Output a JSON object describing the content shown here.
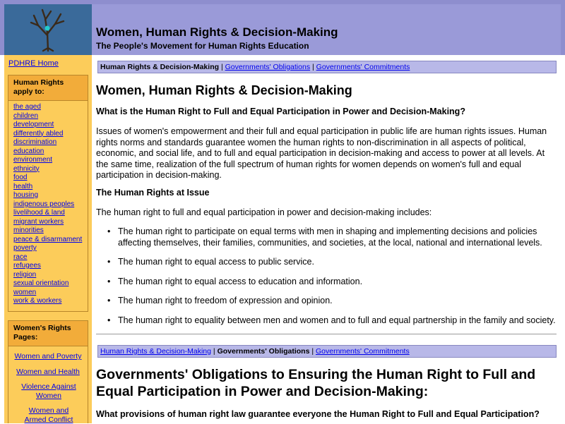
{
  "header": {
    "title": "Women, Human Rights & Decision-Making",
    "subtitle": "The People's Movement for Human Rights Education"
  },
  "sidebar": {
    "home_link": "PDHRE Home",
    "topics_heading": "Human Rights apply to:",
    "topics": [
      "the aged",
      "children",
      "development",
      "differently abled",
      "discrimination",
      "education",
      "environment",
      "ethnicity",
      "food",
      "health",
      "housing",
      "indigenous peoples",
      "livelihood & land",
      "migrant workers",
      "minorities",
      "peace & disarmament",
      "poverty",
      "race",
      "refugees",
      "religion",
      "sexual orientation",
      "women",
      "work & workers"
    ],
    "pages_heading": "Women's Rights Pages:",
    "pages": [
      "Women and Poverty",
      "Women and Health",
      "Violence Against Women",
      "Women and Armed Conflict"
    ]
  },
  "nav": {
    "item1": "Human Rights & Decision-Making",
    "item2": "Governments' Obligations",
    "item3": "Governments' Commitments",
    "separator": "|"
  },
  "content": {
    "title1": "Women, Human Rights & Decision-Making",
    "question1": "What is the Human Right to Full and Equal Participation in Power and Decision-Making?",
    "para1": "Issues of women's empowerment and their full and equal participation in public life are human rights issues. Human rights norms and standards guarantee women the human rights to non-discrimination in all aspects of political, economic, and social life, and to full and equal participation in decision-making and access to power at all levels. At the same time, realization of the full spectrum of human rights for women depends on women's full and equal participation in decision-making.",
    "issue_heading": "The Human Rights at Issue",
    "para2": "The human right to full and equal participation in power and decision-making includes:",
    "rights": [
      "The human right to participate on equal terms with men in shaping and implementing decisions and policies affecting themselves, their families, communities, and societies, at the local, national and international levels.",
      "The human right to equal access to public service.",
      "The human right to equal access to education and information.",
      "The human right to freedom of expression and opinion.",
      "The human right to equality between men and women and to full and equal partnership in the family and society."
    ],
    "title2": "Governments' Obligations to Ensuring the Human Right to Full and Equal Participation in Power and Decision-Making:",
    "question2": "What provisions of human right law guarantee everyone the Human Right to Full and Equal Participation?"
  },
  "icons": {
    "logo": "tree-logo-icon"
  },
  "colors": {
    "header_bg": "#9a9ad8",
    "sidebar_bg": "#fccc5a",
    "sidebar_heading_bg": "#f2ac3a",
    "navbar_bg": "#b8b8e8",
    "logo_bg": "#3a6a9a",
    "link": "#0000ee"
  }
}
